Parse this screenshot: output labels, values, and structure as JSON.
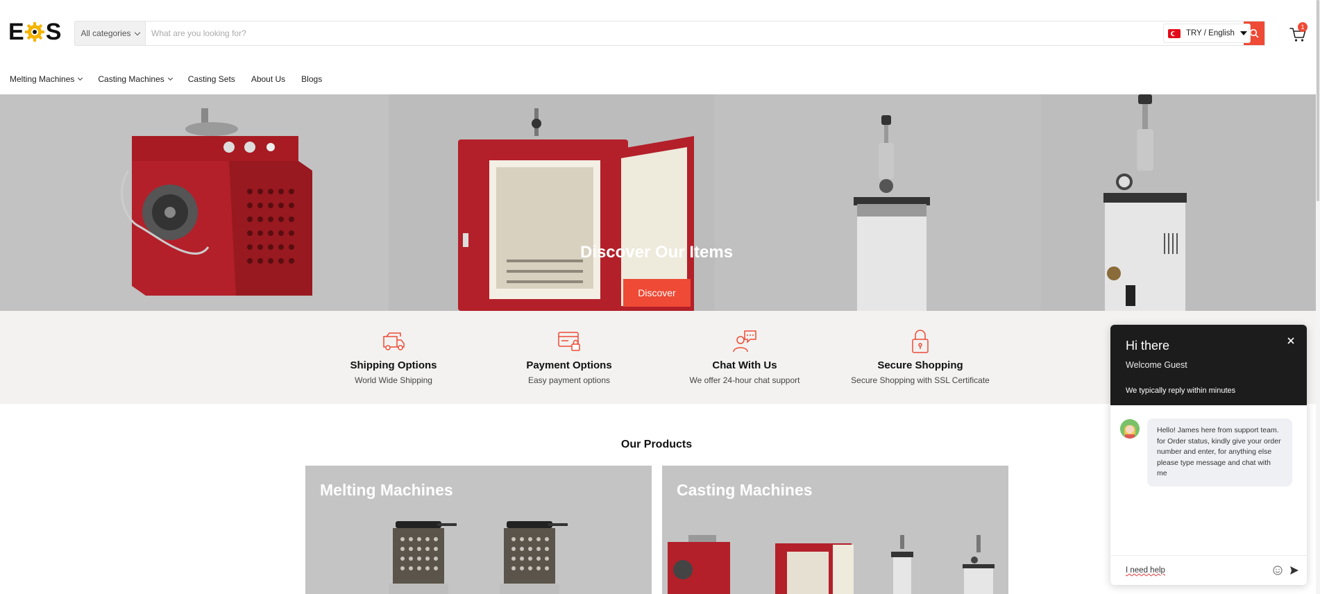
{
  "header": {
    "logo": {
      "left": "E",
      "right": "S"
    },
    "category_select": "All categories",
    "search_placeholder": "What are you looking for?",
    "currency_language": "TRY / English",
    "cart_count": "1"
  },
  "nav": {
    "items": [
      {
        "label": "Melting Machines",
        "dropdown": true
      },
      {
        "label": "Casting Machines",
        "dropdown": true
      },
      {
        "label": "Casting Sets",
        "dropdown": false
      },
      {
        "label": "About Us",
        "dropdown": false
      },
      {
        "label": "Blogs",
        "dropdown": false
      }
    ]
  },
  "hero": {
    "title": "Discover Our Items",
    "button": "Discover"
  },
  "features": [
    {
      "title": "Shipping Options",
      "subtitle": "World Wide Shipping",
      "icon": "truck-icon"
    },
    {
      "title": "Payment Options",
      "subtitle": "Easy payment options",
      "icon": "card-lock-icon"
    },
    {
      "title": "Chat With Us",
      "subtitle": "We offer 24-hour chat support",
      "icon": "chat-support-icon"
    },
    {
      "title": "Secure Shopping",
      "subtitle": "Secure Shopping with SSL Certificate",
      "icon": "padlock-icon"
    }
  ],
  "products": {
    "title": "Our Products",
    "cards": [
      {
        "title": "Melting Machines"
      },
      {
        "title": "Casting Machines"
      }
    ]
  },
  "chat": {
    "greeting": "Hi there",
    "welcome": "Welcome Guest",
    "reply_time": "We typically reply within minutes",
    "message": "Hello! James here from support team. for Order status, kindly give your order number and enter, for anything else please type message and chat with me",
    "input_value": "I need help"
  },
  "colors": {
    "accent": "#ee4a36",
    "chat_header": "#1c1c1c",
    "feature_band": "#f3f2f0"
  }
}
